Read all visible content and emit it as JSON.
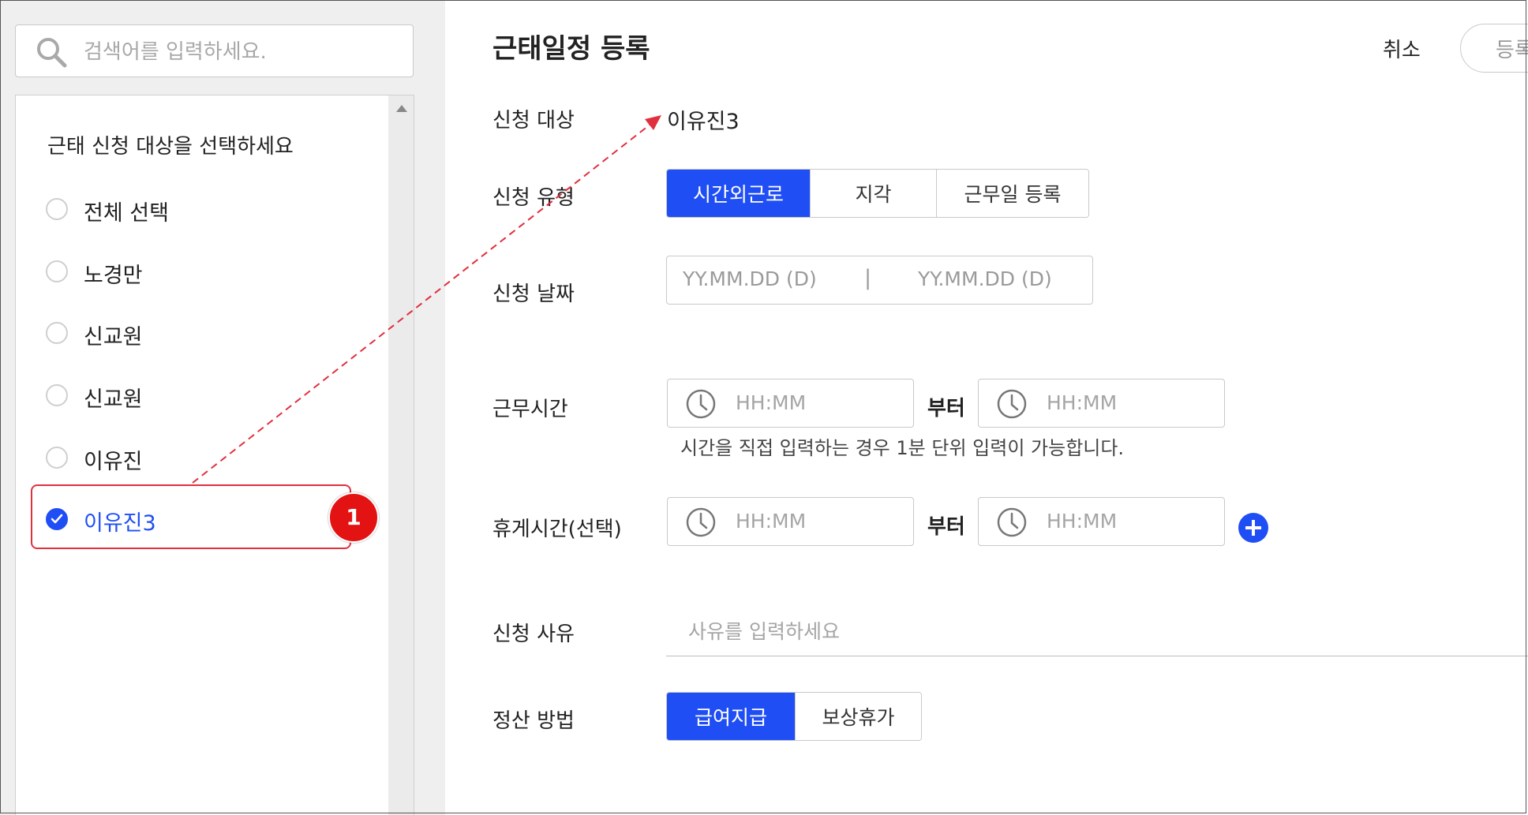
{
  "search": {
    "placeholder": "검색어를 입력하세요."
  },
  "list": {
    "title": "근태 신청 대상을 선택하세요",
    "items": [
      {
        "label": "전체 선택",
        "selected": false
      },
      {
        "label": "노경만",
        "selected": false
      },
      {
        "label": "신교원",
        "selected": false
      },
      {
        "label": "신교원",
        "selected": false
      },
      {
        "label": "이유진",
        "selected": false
      },
      {
        "label": "이유진3",
        "selected": true
      }
    ]
  },
  "annotation": {
    "badge": "1"
  },
  "form": {
    "title": "근태일정 등록",
    "cancel_label": "취소",
    "register_label": "등록",
    "target": {
      "label": "신청 대상",
      "value": "이유진3"
    },
    "type": {
      "label": "신청 유형",
      "options": [
        "시간외근로",
        "지각",
        "근무일 등록"
      ],
      "selected": "시간외근로"
    },
    "date": {
      "label": "신청 날짜",
      "start_placeholder": "YY.MM.DD (D)",
      "separator": "|",
      "end_placeholder": "YY.MM.DD (D)"
    },
    "work_time": {
      "label": "근무시간",
      "start_placeholder": "HH:MM",
      "from_label": "부터",
      "end_placeholder": "HH:MM",
      "hint": "시간을 직접 입력하는 경우 1분 단위 입력이 가능합니다."
    },
    "break_time": {
      "label": "휴게시간(선택)",
      "start_placeholder": "HH:MM",
      "from_label": "부터",
      "end_placeholder": "HH:MM"
    },
    "reason": {
      "label": "신청 사유",
      "placeholder": "사유를 입력하세요"
    },
    "settlement": {
      "label": "정산 방법",
      "options": [
        "급여지급",
        "보상휴가"
      ],
      "selected": "급여지급"
    }
  },
  "colors": {
    "accent": "#1f4ef5",
    "annotation_red": "#e0303e",
    "badge_red": "#e41313"
  }
}
